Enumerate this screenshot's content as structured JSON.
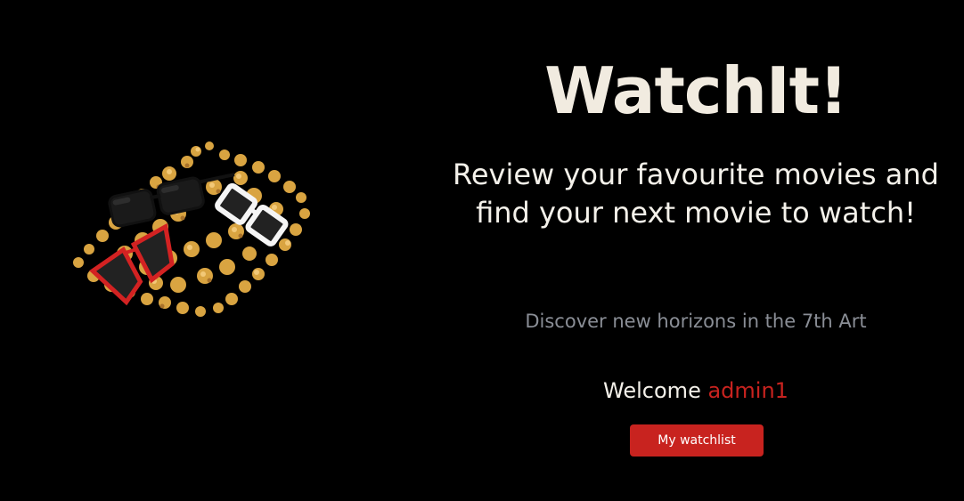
{
  "hero": {
    "title": "WatchIt!",
    "tagline": "Review your favourite movies and find your next movie to watch!",
    "subtitle": "Discover new horizons in the 7th Art",
    "image_name": "popcorn-sunglasses-illustration"
  },
  "welcome": {
    "label": "Welcome",
    "username": "admin1"
  },
  "actions": {
    "watchlist_label": "My watchlist"
  },
  "colors": {
    "background": "#000000",
    "title": "#f1ebe0",
    "accent": "#c8231f",
    "muted": "#8a8e96"
  }
}
